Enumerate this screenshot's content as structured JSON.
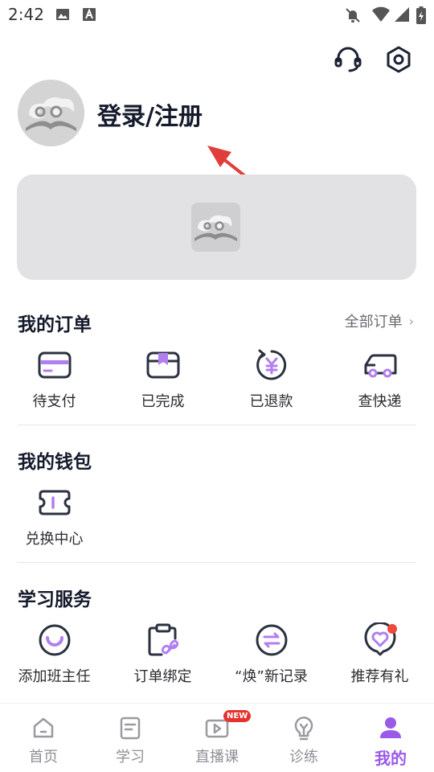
{
  "status_bar": {
    "time": "2:42"
  },
  "header": {
    "login_label": "登录/注册"
  },
  "orders": {
    "title": "我的订单",
    "all_link": "全部订单",
    "items": [
      {
        "label": "待支付",
        "icon": "card-icon"
      },
      {
        "label": "已完成",
        "icon": "bookmark-card-icon"
      },
      {
        "label": "已退款",
        "icon": "refund-yen-icon"
      },
      {
        "label": "查快递",
        "icon": "truck-icon"
      }
    ]
  },
  "wallet": {
    "title": "我的钱包",
    "items": [
      {
        "label": "兑换中心",
        "icon": "ticket-icon"
      }
    ]
  },
  "services": {
    "title": "学习服务",
    "items": [
      {
        "label": "添加班主任",
        "icon": "smile-icon"
      },
      {
        "label": "订单绑定",
        "icon": "clipboard-link-icon"
      },
      {
        "label": "“焕”新记录",
        "icon": "swap-arrows-icon"
      },
      {
        "label": "推荐有礼",
        "icon": "heart-chat-icon"
      }
    ]
  },
  "tabs": [
    {
      "label": "首页",
      "icon": "home-icon"
    },
    {
      "label": "学习",
      "icon": "document-icon"
    },
    {
      "label": "直播课",
      "icon": "live-play-icon",
      "badge": "NEW"
    },
    {
      "label": "诊练",
      "icon": "lightbulb-icon"
    },
    {
      "label": "我的",
      "icon": "user-icon",
      "active": true
    }
  ],
  "colors": {
    "accent": "#9b59e8",
    "icon_dark": "#2b3140",
    "badge_red": "#e5322d",
    "annotation_arrow": "#e23d3d"
  }
}
